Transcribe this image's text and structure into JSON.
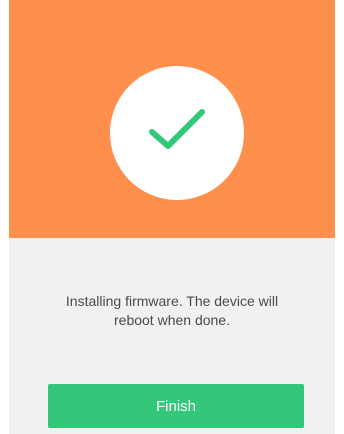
{
  "status": {
    "icon": "checkmark-icon",
    "message_line1": "Installing firmware. The device will",
    "message_line2": "reboot when done."
  },
  "actions": {
    "finish_label": "Finish"
  },
  "colors": {
    "header_background": "#fe8f4d",
    "panel_background": "#f1f1f1",
    "accent": "#33c77a"
  }
}
